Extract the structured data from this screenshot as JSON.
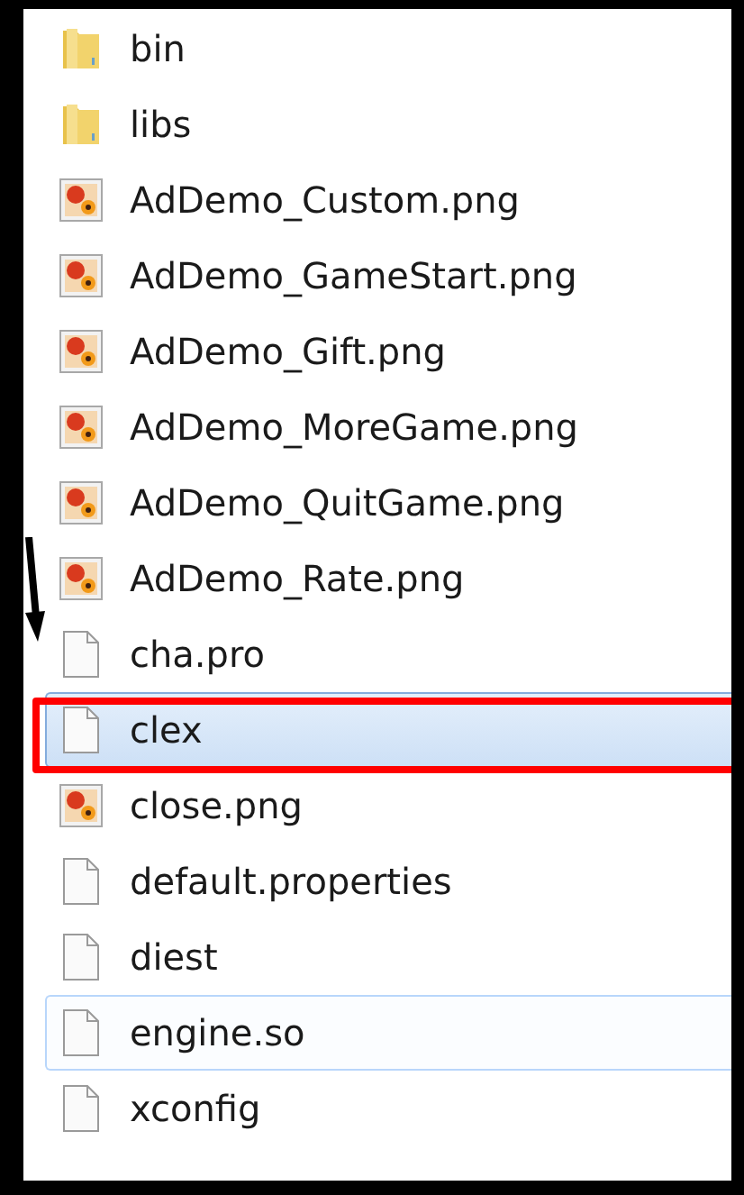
{
  "items": [
    {
      "name": "bin",
      "kind": "folder",
      "selected": false,
      "hovered": false,
      "highlighted": false
    },
    {
      "name": "libs",
      "kind": "folder",
      "selected": false,
      "hovered": false,
      "highlighted": false
    },
    {
      "name": "AdDemo_Custom.png",
      "kind": "image",
      "selected": false,
      "hovered": false,
      "highlighted": false
    },
    {
      "name": "AdDemo_GameStart.png",
      "kind": "image",
      "selected": false,
      "hovered": false,
      "highlighted": false
    },
    {
      "name": "AdDemo_Gift.png",
      "kind": "image",
      "selected": false,
      "hovered": false,
      "highlighted": false
    },
    {
      "name": "AdDemo_MoreGame.png",
      "kind": "image",
      "selected": false,
      "hovered": false,
      "highlighted": false
    },
    {
      "name": "AdDemo_QuitGame.png",
      "kind": "image",
      "selected": false,
      "hovered": false,
      "highlighted": false
    },
    {
      "name": "AdDemo_Rate.png",
      "kind": "image",
      "selected": false,
      "hovered": false,
      "highlighted": false
    },
    {
      "name": "cha.pro",
      "kind": "file",
      "selected": false,
      "hovered": false,
      "highlighted": false
    },
    {
      "name": "clex",
      "kind": "file",
      "selected": true,
      "hovered": false,
      "highlighted": true
    },
    {
      "name": "close.png",
      "kind": "image",
      "selected": false,
      "hovered": false,
      "highlighted": false
    },
    {
      "name": "default.properties",
      "kind": "file",
      "selected": false,
      "hovered": false,
      "highlighted": false
    },
    {
      "name": "diest",
      "kind": "file",
      "selected": false,
      "hovered": false,
      "highlighted": false
    },
    {
      "name": "engine.so",
      "kind": "file",
      "selected": false,
      "hovered": true,
      "highlighted": false
    },
    {
      "name": "xconfig",
      "kind": "file",
      "selected": false,
      "hovered": false,
      "highlighted": false
    }
  ]
}
